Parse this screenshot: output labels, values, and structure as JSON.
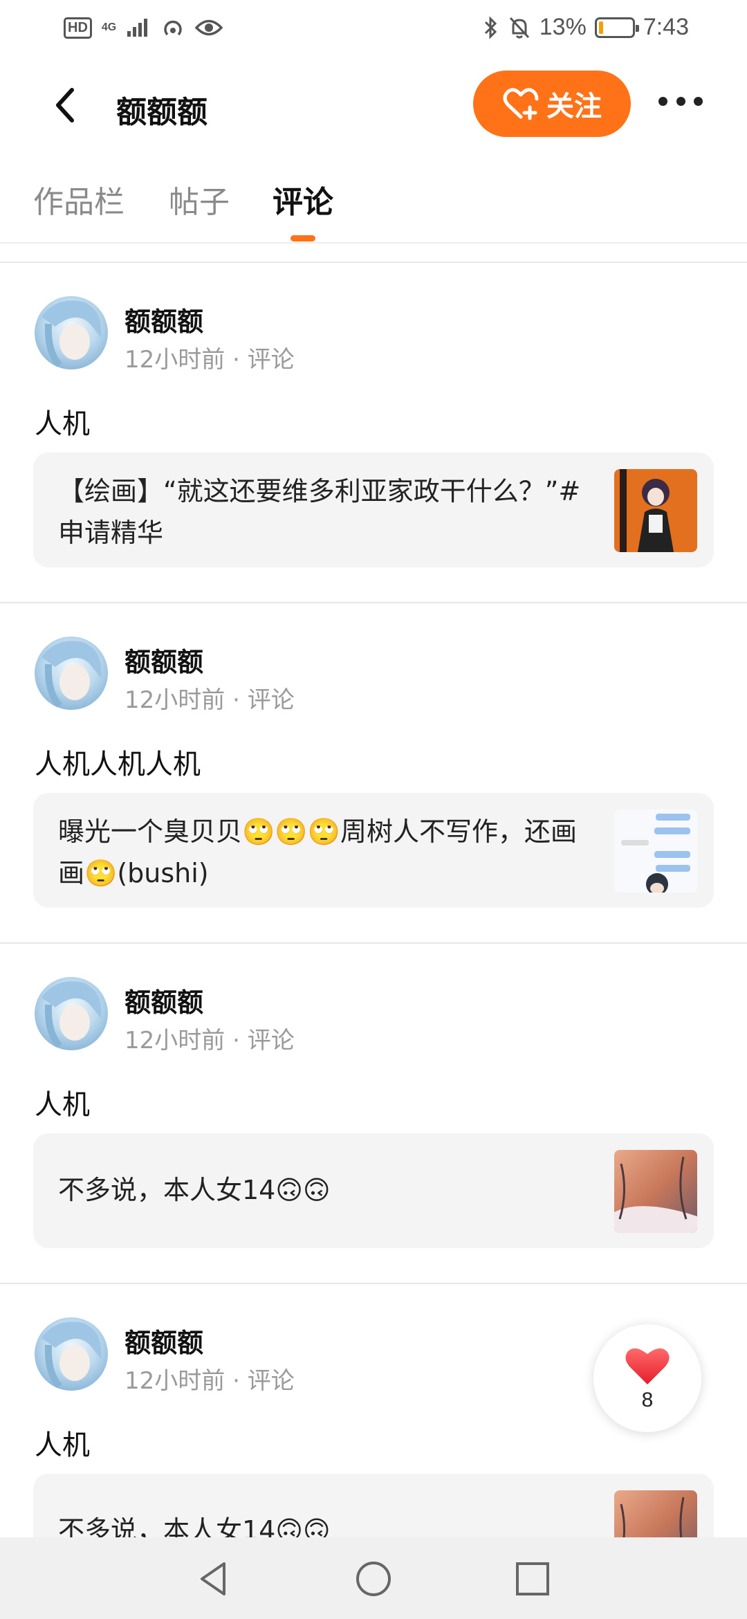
{
  "status_bar": {
    "hd": "HD",
    "network": "4G",
    "battery_percent": "13%",
    "battery_level": 0.13,
    "time": "7:43"
  },
  "header": {
    "title": "额额额",
    "follow_label": "关注"
  },
  "tabs": [
    {
      "label": "作品栏",
      "active": false
    },
    {
      "label": "帖子",
      "active": false
    },
    {
      "label": "评论",
      "active": true
    }
  ],
  "comments": [
    {
      "username": "额额额",
      "time": "12小时前",
      "type": "评论",
      "text": "人机",
      "quote": "【绘画】“就这还要维多利亚家政干什么？”#申请精华"
    },
    {
      "username": "额额额",
      "time": "12小时前",
      "type": "评论",
      "text": "人机人机人机",
      "quote": "曝光一个臭贝贝🙄🙄🙄周树人不写作，还画画🙄(bushi)"
    },
    {
      "username": "额额额",
      "time": "12小时前",
      "type": "评论",
      "text": "人机",
      "quote": "不多说，本人女14🙃🙃"
    },
    {
      "username": "额额额",
      "time": "12小时前",
      "type": "评论",
      "text": "人机",
      "quote": "不多说，本人女14🙃🙃"
    }
  ],
  "like": {
    "count": "8"
  },
  "colors": {
    "accent": "#ff7217",
    "heart": "#f03a3a",
    "card_bg": "#f4f4f4"
  }
}
